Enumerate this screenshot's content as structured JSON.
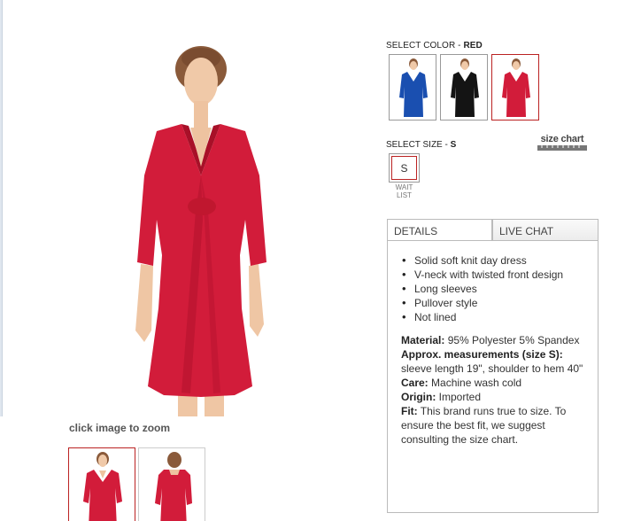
{
  "zoom_hint": "click image to zoom",
  "color": {
    "label": "SELECT COLOR - ",
    "selected": "RED",
    "swatches": [
      {
        "name": "blue",
        "hex": "#1a4fb0"
      },
      {
        "name": "black",
        "hex": "#141414"
      },
      {
        "name": "red",
        "hex": "#d21c3a"
      }
    ]
  },
  "size": {
    "label": "SELECT SIZE - ",
    "selected": "S",
    "option": "S",
    "status_line1": "WAIT",
    "status_line2": "LIST",
    "chart_link": "size chart"
  },
  "tabs": {
    "details": "DETAILS",
    "chat": "LIVE CHAT"
  },
  "details": {
    "bullets": [
      "Solid soft knit day dress",
      "V-neck with twisted front design",
      "Long sleeves",
      "Pullover style",
      "Not lined"
    ],
    "material_label": "Material:",
    "material_value": " 95% Polyester 5% Spandex",
    "measure_label": "Approx. measurements (size S):",
    "measure_value": " sleeve length 19\", shoulder to hem 40\"",
    "care_label": "Care:",
    "care_value": " Machine wash cold",
    "origin_label": "Origin:",
    "origin_value": " Imported",
    "fit_label": "Fit:",
    "fit_value": " This brand runs true to size. To ensure the best fit, we suggest consulting the size chart."
  },
  "colors": {
    "dress": "#d21c3a",
    "accent_border": "#b22222",
    "skin": "#f0c9a8",
    "hair": "#8a5a3a"
  }
}
